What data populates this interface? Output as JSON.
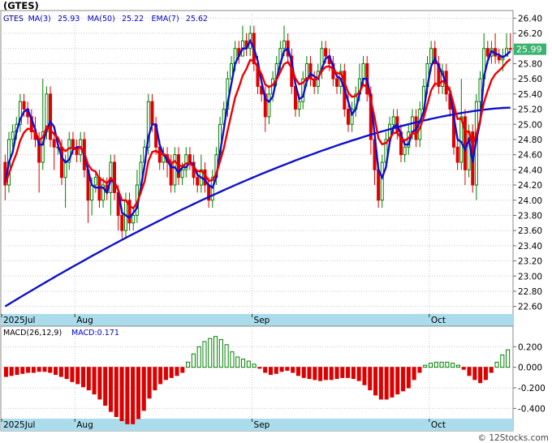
{
  "chart_data": {
    "type": "candlestick",
    "ticker_label": "(GTES)",
    "watermark": "© 12Stocks.com",
    "x_labels": [
      {
        "index": 0,
        "label": "2025Jul"
      },
      {
        "index": 19,
        "label": "Aug"
      },
      {
        "index": 66,
        "label": "Sep"
      },
      {
        "index": 113,
        "label": "Oct"
      }
    ],
    "price_panel": {
      "ylim": [
        22.5,
        26.5
      ],
      "y_ticks": [
        "26.40",
        "26.20",
        "26.00",
        "25.80",
        "25.60",
        "25.40",
        "25.20",
        "25.00",
        "24.80",
        "24.60",
        "24.40",
        "24.20",
        "24.00",
        "23.80",
        "23.60",
        "23.40",
        "23.20",
        "23.00",
        "22.80",
        "22.60"
      ],
      "legend": [
        {
          "text": "GTES",
          "color": "#00008b"
        },
        {
          "text": "MA(3)",
          "color": "#0000cc"
        },
        {
          "text": "25.93",
          "color": "#0000cc"
        },
        {
          "text": "MA(50)",
          "color": "#0000cc"
        },
        {
          "text": "25.22",
          "color": "#0000cc"
        },
        {
          "text": "EMA(7)",
          "color": "#0000cc"
        },
        {
          "text": "25.62",
          "color": "#0000cc"
        }
      ],
      "last_price": "25.99",
      "last_price_value": 25.99,
      "colors": {
        "up": "#008000",
        "up_fill": "#ffffff",
        "down": "#dd0000",
        "ma3": "#1010cc",
        "ma50": "#1010cc",
        "ema7": "#ee0000",
        "last_badge": "#3cb371",
        "axis_band": "#aadcec"
      },
      "candles": [
        [
          24.5,
          24.2,
          24.6,
          24.0
        ],
        [
          24.2,
          24.8,
          24.9,
          24.1
        ],
        [
          24.8,
          24.9,
          25.0,
          24.7
        ],
        [
          24.9,
          25.0,
          25.1,
          24.8
        ],
        [
          25.0,
          25.3,
          25.4,
          24.9
        ],
        [
          25.3,
          25.2,
          25.4,
          25.1
        ],
        [
          25.2,
          25.1,
          25.3,
          25.0
        ],
        [
          25.1,
          24.9,
          25.2,
          24.8
        ],
        [
          24.9,
          24.8,
          25.1,
          24.7
        ],
        [
          24.8,
          24.5,
          24.9,
          24.1
        ],
        [
          24.5,
          24.9,
          25.6,
          24.4
        ],
        [
          24.9,
          25.4,
          25.5,
          24.8
        ],
        [
          25.4,
          24.8,
          25.5,
          24.7
        ],
        [
          24.8,
          24.7,
          24.9,
          24.4
        ],
        [
          24.7,
          24.7,
          24.8,
          24.6
        ],
        [
          24.7,
          24.3,
          24.8,
          24.2
        ],
        [
          24.3,
          24.5,
          24.6,
          23.9
        ],
        [
          24.5,
          24.8,
          24.9,
          24.4
        ],
        [
          24.8,
          24.7,
          24.9,
          24.6
        ],
        [
          24.7,
          24.6,
          24.8,
          24.5
        ],
        [
          24.6,
          24.8,
          24.9,
          24.5
        ],
        [
          24.8,
          24.4,
          24.9,
          24.3
        ],
        [
          24.4,
          24.0,
          24.5,
          23.7
        ],
        [
          24.0,
          24.2,
          24.3,
          23.8
        ],
        [
          24.2,
          24.3,
          24.4,
          24.1
        ],
        [
          24.3,
          24.0,
          24.4,
          23.9
        ],
        [
          24.0,
          24.2,
          24.3,
          23.9
        ],
        [
          24.2,
          24.1,
          24.3,
          24.0
        ],
        [
          24.1,
          24.5,
          24.6,
          23.8
        ],
        [
          24.5,
          24.1,
          24.6,
          24.0
        ],
        [
          24.1,
          23.8,
          24.2,
          23.6
        ],
        [
          23.8,
          23.6,
          23.9,
          23.5
        ],
        [
          23.6,
          24.0,
          24.1,
          23.5
        ],
        [
          24.0,
          23.7,
          24.1,
          23.6
        ],
        [
          23.7,
          23.8,
          23.9,
          23.6
        ],
        [
          23.8,
          24.2,
          24.4,
          23.7
        ],
        [
          24.2,
          24.5,
          24.6,
          24.1
        ],
        [
          24.5,
          24.7,
          24.8,
          24.4
        ],
        [
          24.7,
          25.3,
          25.4,
          24.6
        ],
        [
          25.3,
          25.0,
          25.4,
          24.9
        ],
        [
          25.0,
          24.7,
          25.1,
          24.6
        ],
        [
          24.7,
          24.5,
          24.8,
          24.4
        ],
        [
          24.5,
          24.6,
          24.7,
          24.4
        ],
        [
          24.6,
          24.5,
          24.7,
          24.3
        ],
        [
          24.5,
          24.2,
          24.6,
          24.1
        ],
        [
          24.2,
          24.6,
          24.7,
          24.1
        ],
        [
          24.6,
          24.3,
          24.7,
          24.2
        ],
        [
          24.3,
          24.4,
          24.5,
          24.2
        ],
        [
          24.4,
          24.6,
          24.7,
          24.3
        ],
        [
          24.6,
          24.5,
          24.7,
          24.4
        ],
        [
          24.5,
          24.3,
          24.6,
          24.2
        ],
        [
          24.3,
          24.2,
          24.4,
          24.1
        ],
        [
          24.2,
          24.4,
          24.6,
          24.1
        ],
        [
          24.4,
          24.2,
          24.5,
          24.1
        ],
        [
          24.2,
          24.0,
          24.3,
          23.9
        ],
        [
          24.0,
          24.3,
          24.4,
          23.9
        ],
        [
          24.3,
          24.6,
          24.7,
          24.2
        ],
        [
          24.6,
          25.0,
          25.1,
          24.5
        ],
        [
          25.0,
          25.2,
          25.3,
          24.9
        ],
        [
          25.2,
          25.6,
          25.7,
          25.1
        ],
        [
          25.6,
          25.8,
          25.9,
          25.5
        ],
        [
          25.8,
          26.0,
          26.1,
          25.7
        ],
        [
          26.0,
          25.9,
          26.1,
          25.8
        ],
        [
          25.9,
          26.1,
          26.3,
          25.9
        ],
        [
          26.1,
          26.0,
          26.2,
          25.9
        ],
        [
          26.0,
          26.2,
          26.3,
          25.9
        ],
        [
          26.2,
          25.8,
          26.3,
          25.7
        ],
        [
          25.8,
          25.5,
          25.9,
          25.4
        ],
        [
          25.5,
          25.4,
          25.6,
          25.3
        ],
        [
          25.4,
          25.1,
          25.5,
          24.9
        ],
        [
          25.1,
          25.4,
          25.5,
          25.0
        ],
        [
          25.4,
          25.6,
          25.7,
          25.3
        ],
        [
          25.6,
          25.8,
          25.9,
          25.5
        ],
        [
          25.8,
          26.0,
          26.1,
          25.7
        ],
        [
          26.0,
          26.1,
          26.3,
          25.9
        ],
        [
          26.1,
          25.9,
          26.2,
          25.8
        ],
        [
          25.9,
          25.5,
          26.0,
          25.4
        ],
        [
          25.5,
          25.2,
          25.6,
          25.1
        ],
        [
          25.2,
          25.3,
          25.4,
          25.1
        ],
        [
          25.3,
          25.6,
          25.7,
          25.2
        ],
        [
          25.6,
          25.8,
          25.9,
          25.5
        ],
        [
          25.8,
          25.6,
          25.9,
          25.5
        ],
        [
          25.6,
          25.5,
          25.7,
          25.4
        ],
        [
          25.5,
          25.7,
          25.8,
          25.4
        ],
        [
          25.7,
          26.0,
          26.1,
          25.6
        ],
        [
          26.0,
          25.9,
          26.1,
          25.8
        ],
        [
          25.9,
          25.8,
          26.0,
          25.7
        ],
        [
          25.8,
          25.6,
          25.9,
          25.5
        ],
        [
          25.6,
          25.5,
          25.7,
          25.4
        ],
        [
          25.5,
          25.7,
          25.8,
          25.4
        ],
        [
          25.7,
          25.2,
          25.8,
          25.1
        ],
        [
          25.2,
          25.0,
          25.4,
          24.9
        ],
        [
          25.0,
          25.2,
          25.3,
          24.9
        ],
        [
          25.2,
          25.4,
          25.5,
          25.1
        ],
        [
          25.4,
          25.6,
          25.8,
          25.3
        ],
        [
          25.6,
          25.8,
          25.9,
          25.5
        ],
        [
          25.8,
          25.4,
          25.9,
          25.3
        ],
        [
          25.4,
          24.8,
          25.5,
          24.6
        ],
        [
          24.8,
          24.4,
          24.9,
          24.2
        ],
        [
          24.4,
          24.0,
          24.5,
          23.9
        ],
        [
          24.0,
          24.5,
          24.6,
          23.9
        ],
        [
          24.5,
          24.8,
          24.9,
          24.4
        ],
        [
          24.8,
          25.0,
          25.1,
          24.7
        ],
        [
          25.0,
          25.1,
          25.2,
          24.9
        ],
        [
          25.1,
          24.9,
          25.2,
          24.8
        ],
        [
          24.9,
          24.6,
          25.0,
          24.5
        ],
        [
          24.6,
          24.7,
          24.8,
          24.5
        ],
        [
          24.7,
          24.9,
          25.0,
          24.6
        ],
        [
          24.9,
          25.1,
          25.2,
          24.8
        ],
        [
          25.1,
          24.8,
          25.2,
          24.7
        ],
        [
          24.8,
          25.2,
          25.3,
          24.7
        ],
        [
          25.2,
          25.5,
          25.6,
          25.1
        ],
        [
          25.5,
          25.8,
          25.9,
          25.4
        ],
        [
          25.8,
          26.0,
          26.1,
          25.7
        ],
        [
          26.0,
          25.8,
          26.1,
          25.5
        ],
        [
          25.8,
          25.5,
          25.9,
          25.4
        ],
        [
          25.5,
          25.7,
          25.8,
          25.4
        ],
        [
          25.7,
          25.4,
          25.8,
          25.3
        ],
        [
          25.4,
          25.2,
          25.5,
          25.1
        ],
        [
          25.2,
          24.7,
          25.3,
          24.6
        ],
        [
          24.7,
          24.5,
          24.8,
          24.4
        ],
        [
          24.5,
          25.1,
          25.6,
          24.4
        ],
        [
          25.1,
          24.4,
          25.2,
          24.2
        ],
        [
          24.4,
          24.9,
          25.0,
          24.3
        ],
        [
          24.9,
          24.2,
          25.0,
          24.1
        ],
        [
          24.2,
          25.3,
          25.4,
          24.0
        ],
        [
          25.3,
          25.6,
          25.7,
          25.2
        ],
        [
          25.6,
          26.0,
          26.2,
          25.5
        ],
        [
          26.0,
          25.9,
          26.1,
          25.8
        ],
        [
          25.9,
          26.0,
          26.1,
          25.8
        ],
        [
          26.0,
          25.9,
          26.2,
          25.8
        ],
        [
          25.9,
          25.85,
          26.0,
          25.8
        ],
        [
          25.85,
          25.9,
          26.0,
          25.7
        ],
        [
          25.9,
          26.0,
          26.2,
          25.9
        ],
        [
          26.0,
          25.99,
          26.2,
          25.95
        ]
      ],
      "ma3": [],
      "ma50": [],
      "ema7": []
    },
    "macd_panel": {
      "label": "MACD(26,12,9)",
      "value_label": "MACD:0.171",
      "ylim": [
        -0.5,
        0.4
      ],
      "y_ticks": [
        "0.200",
        "0.000",
        "-0.200",
        "-0.400"
      ],
      "values": [
        -0.09,
        -0.08,
        -0.07,
        -0.06,
        -0.05,
        -0.05,
        -0.04,
        -0.04,
        -0.05,
        -0.07,
        -0.09,
        -0.11,
        -0.14,
        -0.16,
        -0.19,
        -0.22,
        -0.26,
        -0.31,
        -0.37,
        -0.43,
        -0.48,
        -0.52,
        -0.55,
        -0.55,
        -0.5,
        -0.42,
        -0.3,
        -0.22,
        -0.16,
        -0.12,
        -0.1,
        -0.08,
        -0.05,
        0.05,
        0.13,
        0.2,
        0.25,
        0.28,
        0.3,
        0.27,
        0.22,
        0.15,
        0.1,
        0.08,
        0.06,
        0.03,
        -0.01,
        -0.05,
        -0.07,
        -0.06,
        -0.04,
        -0.03,
        -0.05,
        -0.08,
        -0.1,
        -0.11,
        -0.12,
        -0.13,
        -0.12,
        -0.12,
        -0.11,
        -0.1,
        -0.1,
        -0.11,
        -0.13,
        -0.17,
        -0.22,
        -0.27,
        -0.31,
        -0.31,
        -0.29,
        -0.26,
        -0.23,
        -0.2,
        -0.12,
        -0.05,
        0.02,
        0.04,
        0.05,
        0.05,
        0.05,
        0.04,
        0.02,
        -0.02,
        -0.08,
        -0.12,
        -0.15,
        -0.12,
        -0.05,
        0.05,
        0.12,
        0.17
      ]
    }
  }
}
